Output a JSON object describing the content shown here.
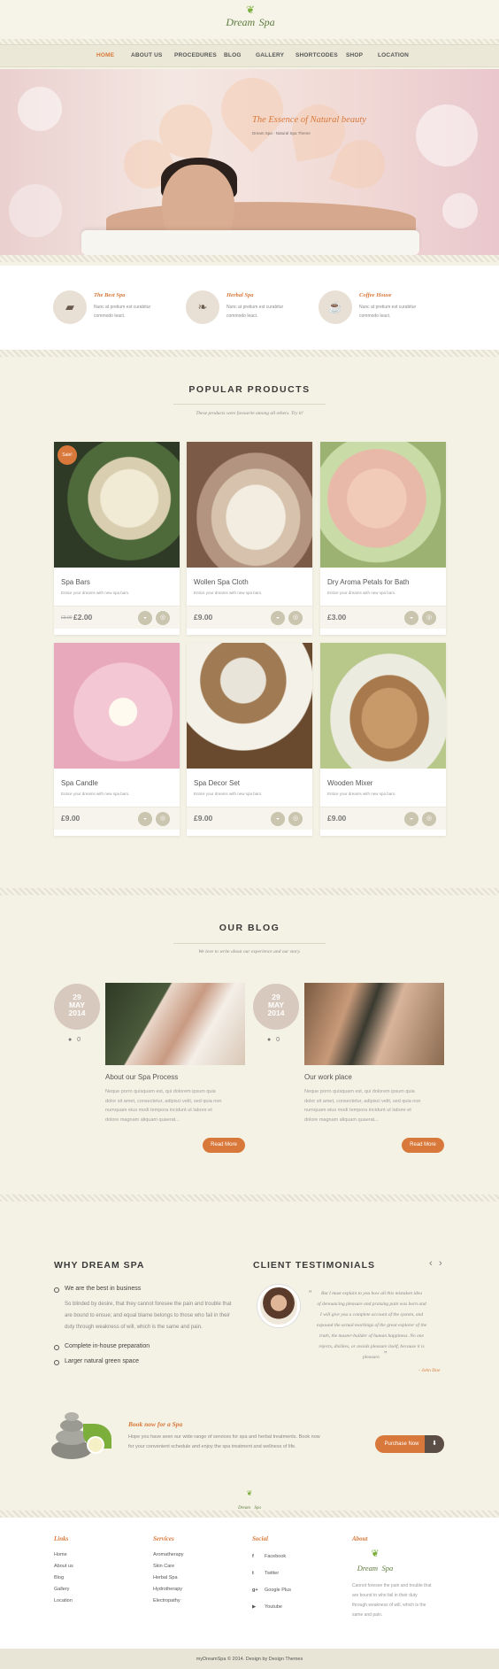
{
  "brand": {
    "name_a": "Dream",
    "name_b": "Spa"
  },
  "nav": {
    "items": [
      "HOME",
      "ABOUT US",
      "PROCEDURES",
      "BLOG",
      "GALLERY",
      "SHORTCODES",
      "SHOP",
      "LOCATION"
    ]
  },
  "hero": {
    "title": "The Essence of Natural beauty",
    "subtitle": "Dream Spa - Natural Spa Theme"
  },
  "features": [
    {
      "title": "The Best Spa",
      "text_a": "Nunc at pretium est curabitur",
      "text_b": "commodo leact.",
      "icon": "spa-icon"
    },
    {
      "title": "Herbal Spa",
      "text_a": "Nunc at pretium est curabitur",
      "text_b": "commodo leact.",
      "icon": "leaf-icon"
    },
    {
      "title": "Coffee House",
      "text_a": "Nunc at pretium est curabitur",
      "text_b": "commodo leact.",
      "icon": "coffee-icon"
    }
  ],
  "products": {
    "title": "POPULAR PRODUCTS",
    "subtitle": "These products were favourite among all others. Try it!",
    "sale_label": "Sale!",
    "items": [
      {
        "name": "Spa Bars",
        "desc": "Entice your dreams with new spa bars.",
        "old_price": "£3.00",
        "price": "£2.00"
      },
      {
        "name": "Wollen Spa Cloth",
        "desc": "Entice your dreams with new spa bars.",
        "price": "£9.00"
      },
      {
        "name": "Dry Aroma Petals for Bath",
        "desc": "Entice your dreams with new spa bars.",
        "price": "£3.00"
      },
      {
        "name": "Spa Candle",
        "desc": "Entice your dreams with new spa bars.",
        "price": "£9.00"
      },
      {
        "name": "Spa Decor Set",
        "desc": "Entice your dreams with new spa bars.",
        "price": "£9.00"
      },
      {
        "name": "Wooden Mixer",
        "desc": "Entice your dreams with new spa bars.",
        "price": "£9.00"
      }
    ]
  },
  "blog": {
    "title": "OUR BLOG",
    "subtitle": "We love to write about our experience and our story.",
    "read_more": "Read More",
    "posts": [
      {
        "day": "29",
        "month": "MAY",
        "year": "2014",
        "comments": "0",
        "title": "About our Spa Process",
        "lines": [
          "Neque porro quisquam est, qui dolorem ipsum quia",
          "dolor sit amet, consectetur, adipisci velit, sed quia non",
          "numquam eius modi tempora incidunt ut labore et",
          "dolore magnam aliquam quaerat..."
        ]
      },
      {
        "day": "29",
        "month": "MAY",
        "year": "2014",
        "comments": "0",
        "title": "Our work place",
        "lines": [
          "Neque porro quisquam est, qui dolorem ipsum quia",
          "dolor sit amet, consectetur, adipisci velit, sed quia non",
          "numquam eius modi tempora incidunt ut labore et",
          "dolore magnam aliquam quaerat..."
        ]
      }
    ]
  },
  "why": {
    "title": "WHY DREAM SPA",
    "items": [
      "We are the best in business",
      "Complete in-house preparation",
      "Larger natural green space"
    ],
    "text": [
      "So blinded by desire, that they cannot foresee the pain and trouble that",
      "are bound to ensue; and equal blame belongs to those who fail in their",
      "duty through weakness of will, which is the same and pain."
    ]
  },
  "testimonials": {
    "title": "CLIENT TESTIMONIALS",
    "lines": [
      "But I must explain to you how all this mistaken idea",
      "of denouncing pleasure and praising pain was born and",
      "I will give you a complete account of the system, and",
      "expound the actual teachings of the great explorer of the",
      "truth, the master-builder of human happiness. No one",
      "rejects, dislikes, or avoids pleasure itself, because it is",
      "pleasure."
    ],
    "author": "- John Doe"
  },
  "booking": {
    "title": "Book now for a Spa",
    "lines": [
      "Hope you have seen our wide range of services for spa and herbal treatments. Book now",
      "for your convenient schedule and enjoy the spa treatment and wellness of life."
    ],
    "button": "Purchase Now"
  },
  "footer": {
    "links_title": "Links",
    "links": [
      "Home",
      "About us",
      "Blog",
      "Gallery",
      "Location"
    ],
    "services_title": "Services",
    "services": [
      "Aromatherapy",
      "Skin Care",
      "Herbal Spa",
      "Hydrotherapy",
      "Electropathy"
    ],
    "social_title": "Social",
    "social": [
      {
        "label": "Facebook",
        "icon": "f"
      },
      {
        "label": "Twitter",
        "icon": "t"
      },
      {
        "label": "Google Plus",
        "icon": "g+"
      },
      {
        "label": "Youtube",
        "icon": "▶"
      }
    ],
    "about_title": "About",
    "about_lines": [
      "Cannot foresee the pain and trouble that",
      "are bound to who fail in their duty",
      "through weakness of will, which is the",
      "same and pain."
    ],
    "copyright": "myDreamSpa © 2014. Design by Design Themes"
  },
  "colors": {
    "accent": "#d8783a",
    "background": "#f4f2e4",
    "nav": "#ebe8d8"
  }
}
